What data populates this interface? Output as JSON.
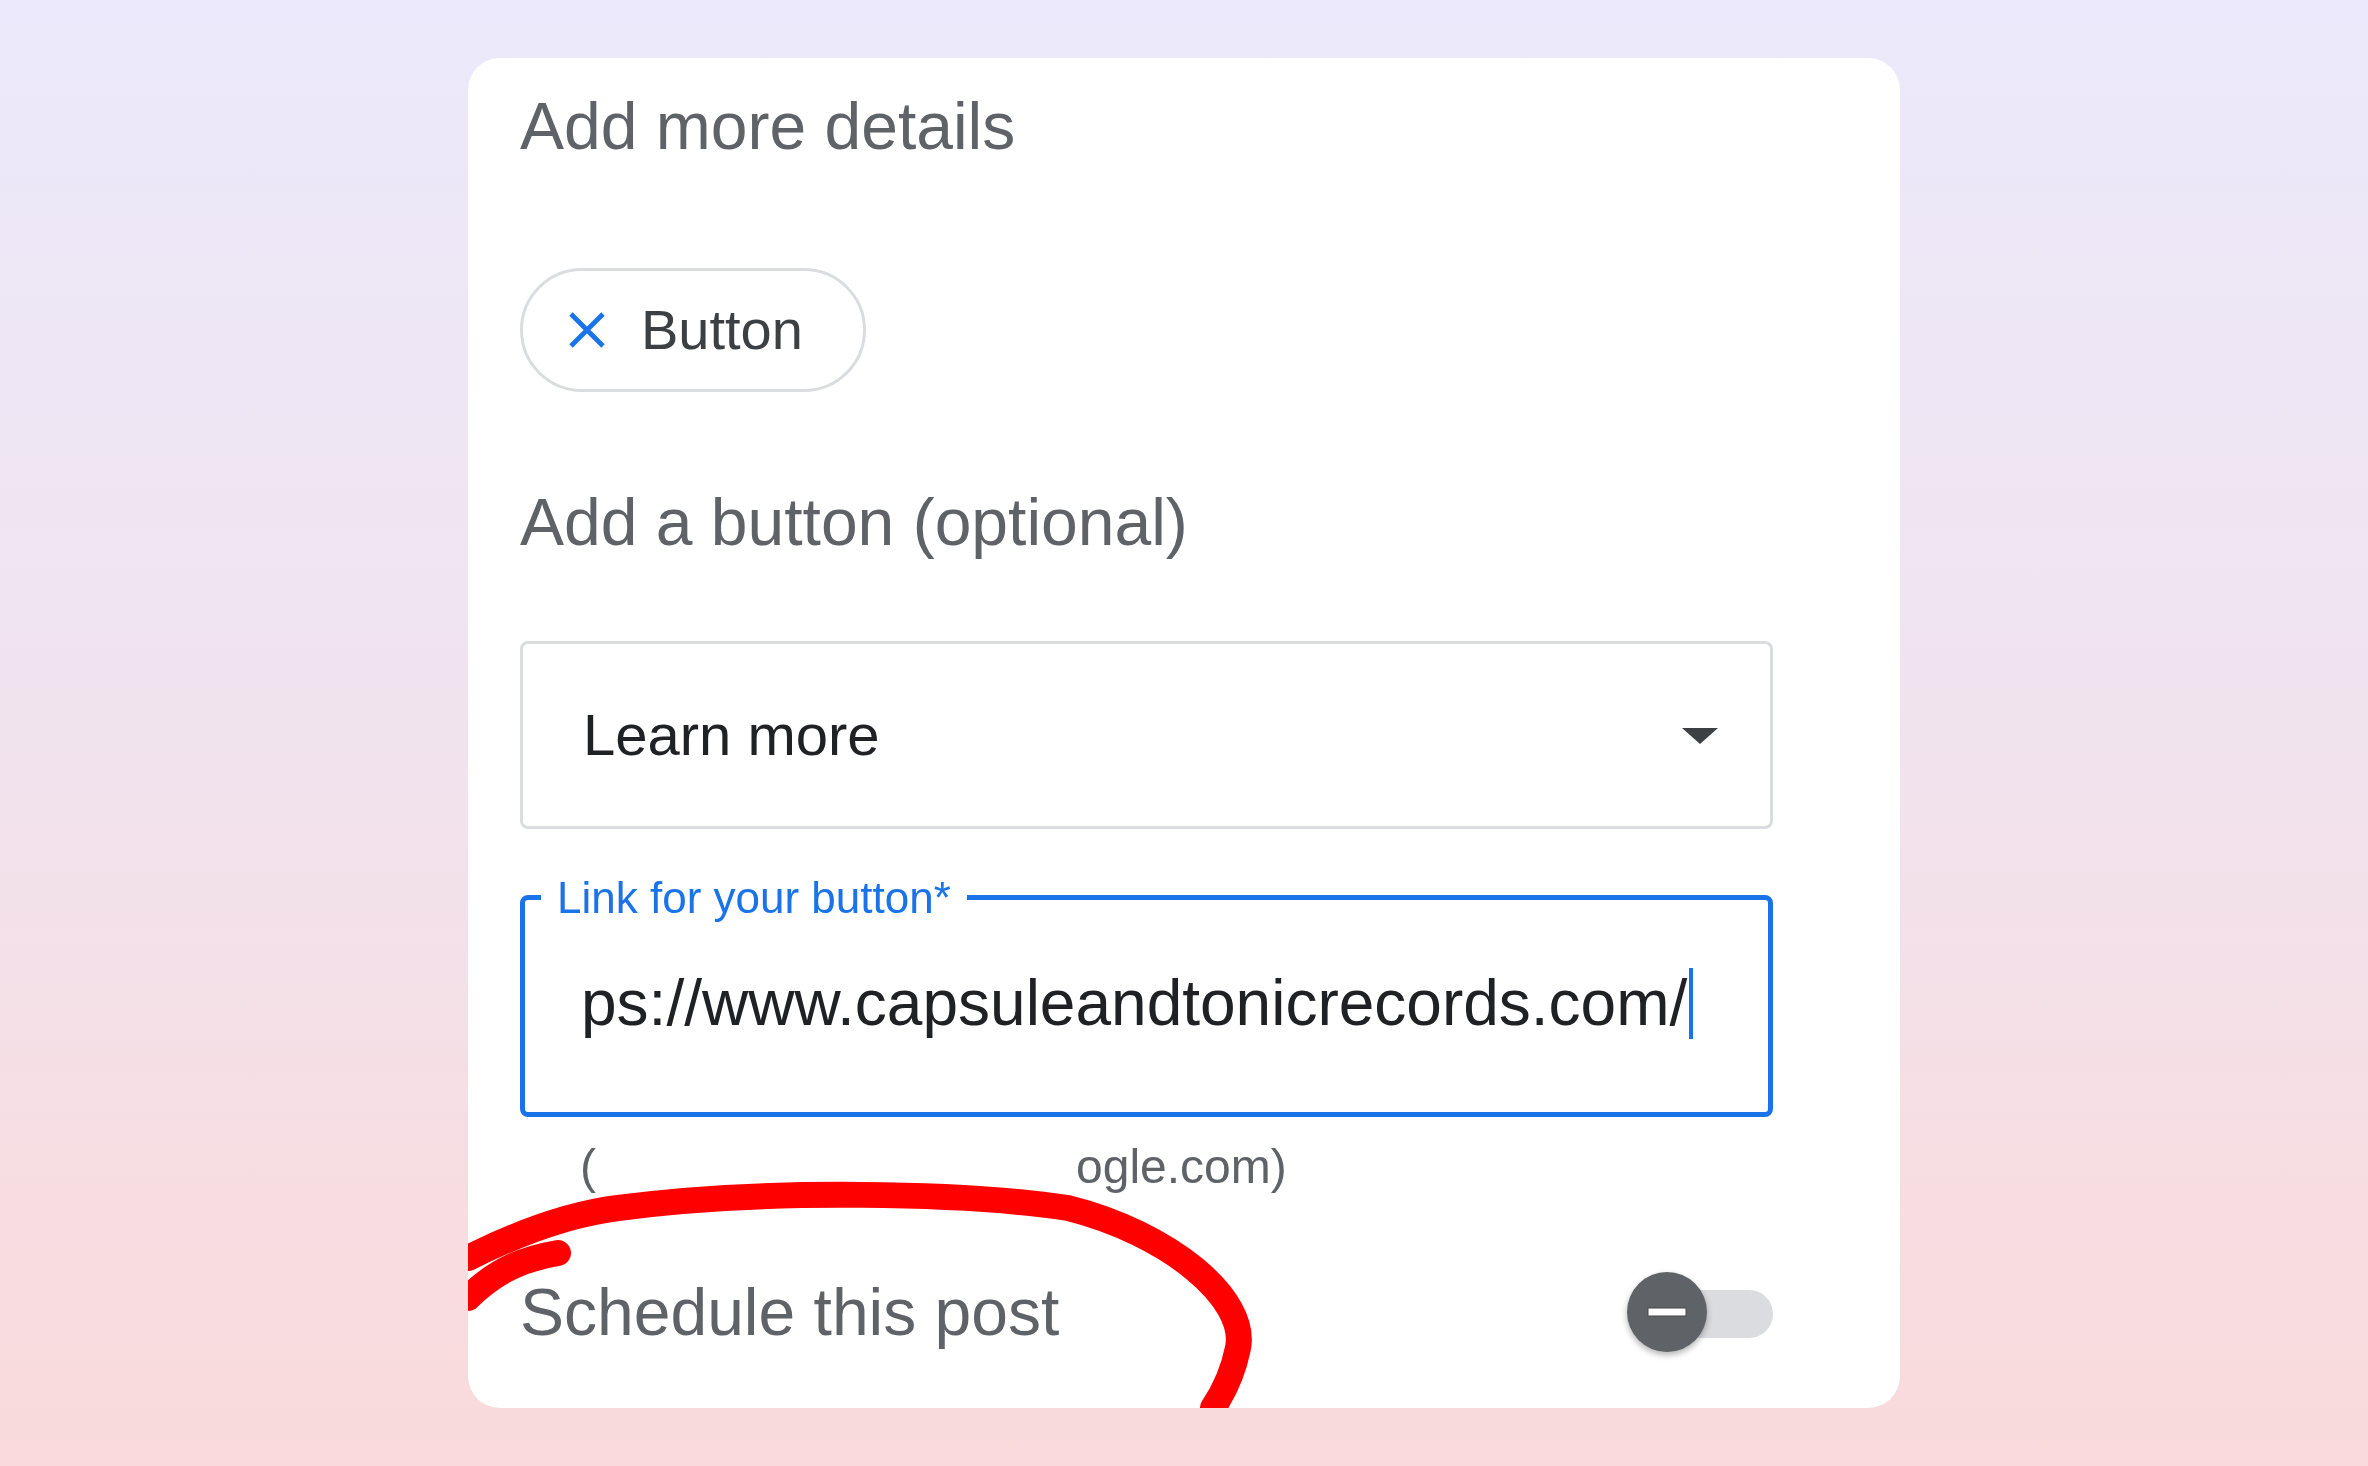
{
  "section_title": "Add more details",
  "chips": [
    {
      "label": "Button",
      "selected": true
    }
  ],
  "button_section_title": "Add a button (optional)",
  "action_select": {
    "value": "Learn more"
  },
  "link_field": {
    "label": "Link for your button*",
    "value": "ps://www.capsuleandtonicrecords.com/",
    "focused": true,
    "helper_parts": [
      "(",
      "ogle.com)"
    ]
  },
  "schedule": {
    "label": "Schedule this post",
    "on": false
  },
  "annotation": {
    "kind": "circle",
    "color": "#ff0000"
  }
}
